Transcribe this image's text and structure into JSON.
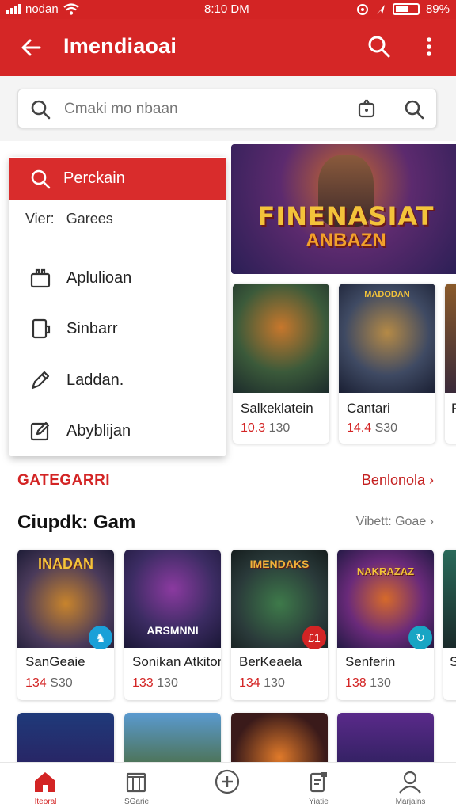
{
  "status_bar": {
    "carrier": "nodan",
    "time": "8:10 DM",
    "battery": "89%"
  },
  "app_bar": {
    "title": "Imendiaoai"
  },
  "search": {
    "placeholder": "Cmaki mo nbaan"
  },
  "menu": {
    "active_label": "Perckain",
    "sub_prefix": "Vier:",
    "sub_label": "Garees",
    "items": [
      {
        "label": "Aplulioan",
        "icon": "bag-icon"
      },
      {
        "label": "Sinbarr",
        "icon": "tablet-icon"
      },
      {
        "label": "Laddan.",
        "icon": "pen-icon"
      },
      {
        "label": "Abyblijan",
        "icon": "edit-icon"
      }
    ]
  },
  "banner": {
    "line1": "FINENASIAT",
    "line2": "ANBAZN"
  },
  "top_cards": [
    {
      "name": "Salkeklatein",
      "price_red": "10.3",
      "price_gray": "130"
    },
    {
      "name": "Cantari",
      "price_red": "14.4",
      "price_gray": "S30",
      "thumb_text": "MADODAN"
    },
    {
      "name": "P",
      "price_red": "",
      "price_gray": ""
    }
  ],
  "categories": {
    "title": "GATEGARRI",
    "link": "Benlonola"
  },
  "section": {
    "title": "Ciupdk: Gam",
    "link": "Vibett: Goae"
  },
  "game_cards": [
    {
      "name": "SanGeaie",
      "price_red": "134",
      "price_gray": "S30",
      "thumb_title": "INADAN",
      "badge": "♞",
      "badge_color": "#1aa0d8"
    },
    {
      "name": "Sonikan Atkiton",
      "price_red": "133",
      "price_gray": "130",
      "thumb_title": "ARSMNNI",
      "badge": "",
      "badge_color": ""
    },
    {
      "name": "BerKeaela",
      "price_red": "134",
      "price_gray": "130",
      "thumb_title": "IMENDAKS",
      "badge": "£1",
      "badge_color": "#d32424"
    },
    {
      "name": "Senferin",
      "price_red": "138",
      "price_gray": "130",
      "thumb_title": "NAKRAZAZ",
      "badge": "↻",
      "badge_color": "#18a5c4"
    },
    {
      "name": "S",
      "price_red": "",
      "price_gray": "",
      "thumb_title": "",
      "badge": "",
      "badge_color": ""
    }
  ],
  "bottom_nav": [
    {
      "label": "Iteoral",
      "icon": "home-icon",
      "active": true
    },
    {
      "label": "SGarie",
      "icon": "library-icon",
      "active": false
    },
    {
      "label": "",
      "icon": "add-circle-icon",
      "active": false
    },
    {
      "label": "Yiatie",
      "icon": "notes-icon",
      "active": false
    },
    {
      "label": "Marjains",
      "icon": "profile-icon",
      "active": false
    }
  ],
  "colors": {
    "accent": "#d32424",
    "price_red": "#d32424",
    "text_muted": "#777777"
  }
}
